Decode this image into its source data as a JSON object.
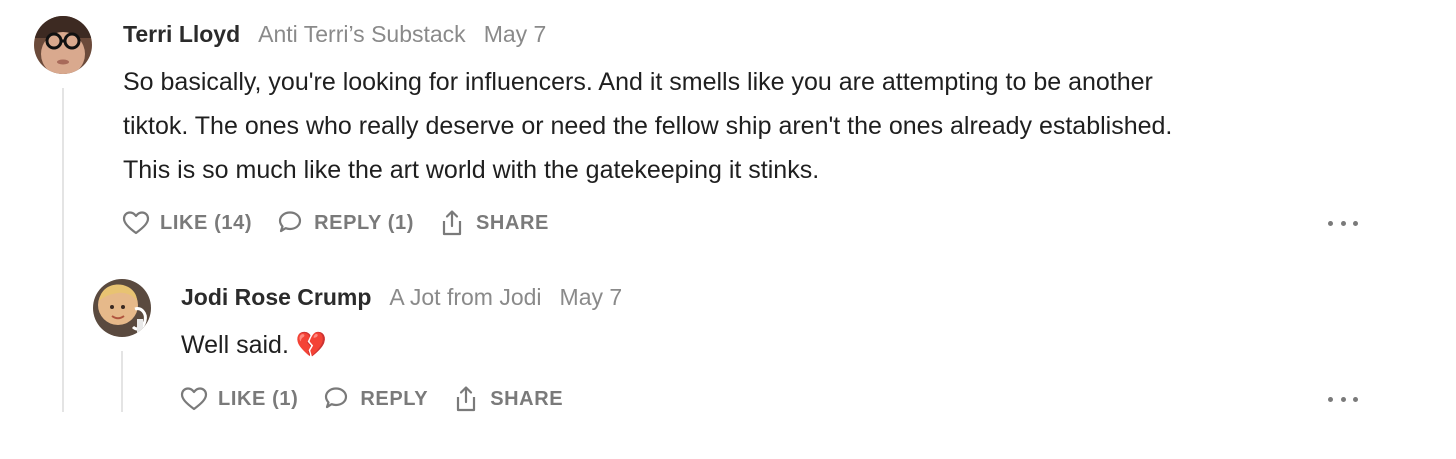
{
  "comments": [
    {
      "author": "Terri Lloyd",
      "publication": "Anti Terri’s Substack",
      "date": "May 7",
      "body": [
        "So basically, you're looking for influencers. And it smells like you are attempting to be another",
        "tiktok. The ones who really deserve or need the fellow ship aren't the ones already established.",
        "This is so much like the art world with the gatekeeping it stinks."
      ],
      "like_label": "LIKE (14)",
      "reply_label": "REPLY (1)",
      "share_label": "SHARE"
    },
    {
      "author": "Jodi Rose Crump",
      "publication": "A Jot from Jodi",
      "date": "May 7",
      "body_text": "Well said.",
      "emoji": "💔",
      "like_label": "LIKE (1)",
      "reply_label": "REPLY",
      "share_label": "SHARE"
    }
  ],
  "icons": {
    "like": "heart-icon",
    "reply": "speech-bubble-icon",
    "share": "share-icon",
    "more": "more-dots-icon"
  },
  "colors": {
    "meta_gray": "#8a8a8a",
    "action_gray": "#7a7a7a",
    "thread_line": "#e4e4e4",
    "emoji_red": "#e0245e"
  }
}
